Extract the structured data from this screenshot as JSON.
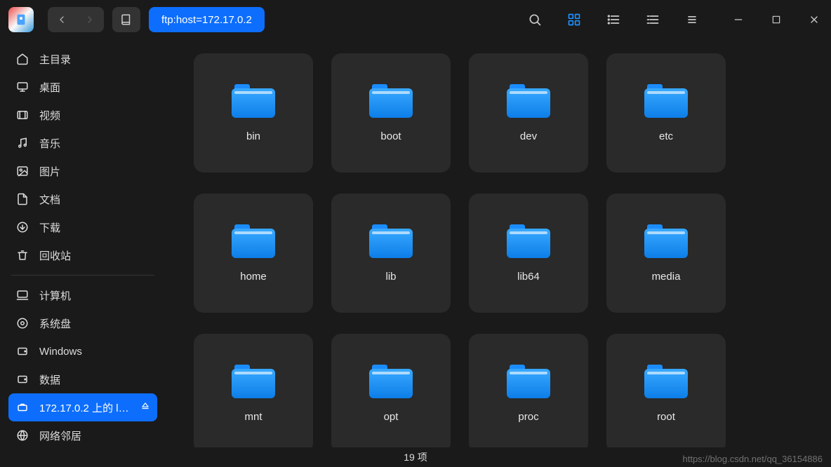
{
  "address": "ftp:host=172.17.0.2",
  "sidebar": {
    "items": [
      {
        "icon": "home",
        "label": "主目录"
      },
      {
        "icon": "desktop",
        "label": "桌面"
      },
      {
        "icon": "video",
        "label": "视频"
      },
      {
        "icon": "music",
        "label": "音乐"
      },
      {
        "icon": "image",
        "label": "图片"
      },
      {
        "icon": "document",
        "label": "文档"
      },
      {
        "icon": "download",
        "label": "下载"
      },
      {
        "icon": "trash",
        "label": "回收站"
      }
    ],
    "devices": [
      {
        "icon": "computer",
        "label": "计算机"
      },
      {
        "icon": "system-disk",
        "label": "系统盘"
      },
      {
        "icon": "disk",
        "label": "Windows"
      },
      {
        "icon": "disk",
        "label": "数据"
      }
    ],
    "network": [
      {
        "icon": "remote",
        "label": "172.17.0.2 上的 li…",
        "selected": true,
        "eject": true
      },
      {
        "icon": "network",
        "label": "网络邻居"
      }
    ]
  },
  "folders": [
    "bin",
    "boot",
    "dev",
    "etc",
    "home",
    "lib",
    "lib64",
    "media",
    "mnt",
    "opt",
    "proc",
    "root"
  ],
  "status": "19 项",
  "watermark": "https://blog.csdn.net/qq_36154886"
}
